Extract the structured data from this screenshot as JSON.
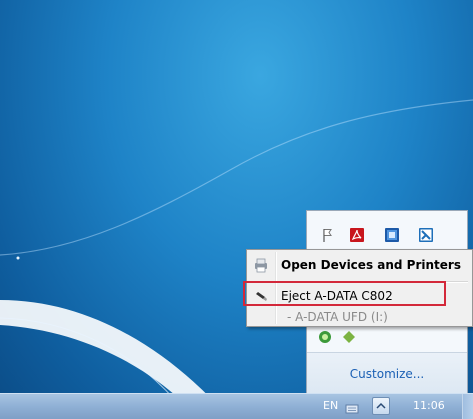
{
  "context_menu": {
    "items": [
      {
        "label": "Open Devices and Printers",
        "icon": "devices-printers-icon",
        "bold": true
      },
      {
        "label": "Eject A-DATA C802",
        "icon": "usb-drive-icon",
        "bold": false
      },
      {
        "label": "- A-DATA UFD (I:)",
        "icon": "",
        "disabled": true
      }
    ]
  },
  "tray_flyout": {
    "icons": [
      "flag-icon",
      "pdf-icon",
      "blue-app-icon",
      "blue-app-2-icon",
      "green-app-icon",
      "green-app-2-icon"
    ],
    "customize_label": "Customize..."
  },
  "taskbar": {
    "language": "EN",
    "clock": "11:06"
  },
  "colors": {
    "desktop_blue": "#1e83c7",
    "highlight_red": "#d3283a",
    "link_blue": "#1a5fb4"
  }
}
